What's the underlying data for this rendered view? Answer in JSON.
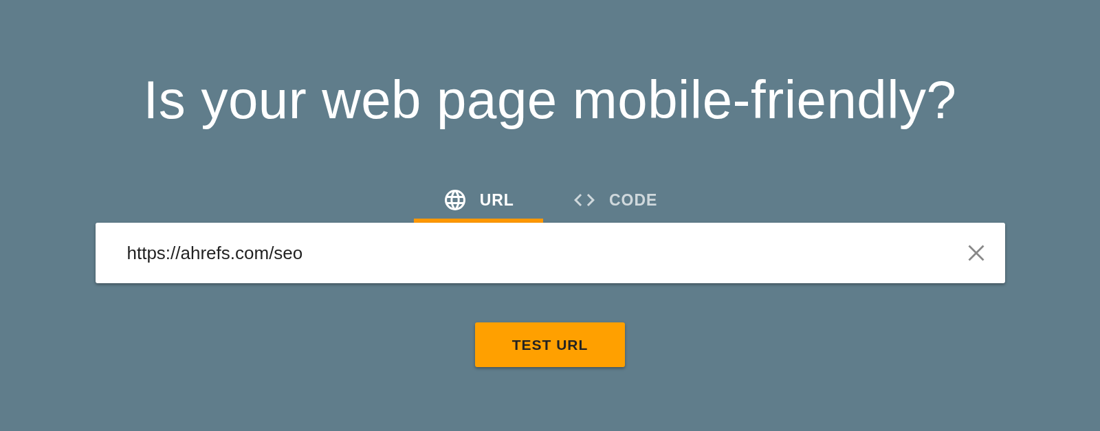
{
  "heading": "Is your web page mobile-friendly?",
  "tabs": [
    {
      "label": "URL",
      "kind": "globe",
      "selected": true
    },
    {
      "label": "CODE",
      "kind": "code",
      "selected": false
    }
  ],
  "url_field": {
    "value": "https://ahrefs.com/seo"
  },
  "button": {
    "label": "TEST URL"
  }
}
